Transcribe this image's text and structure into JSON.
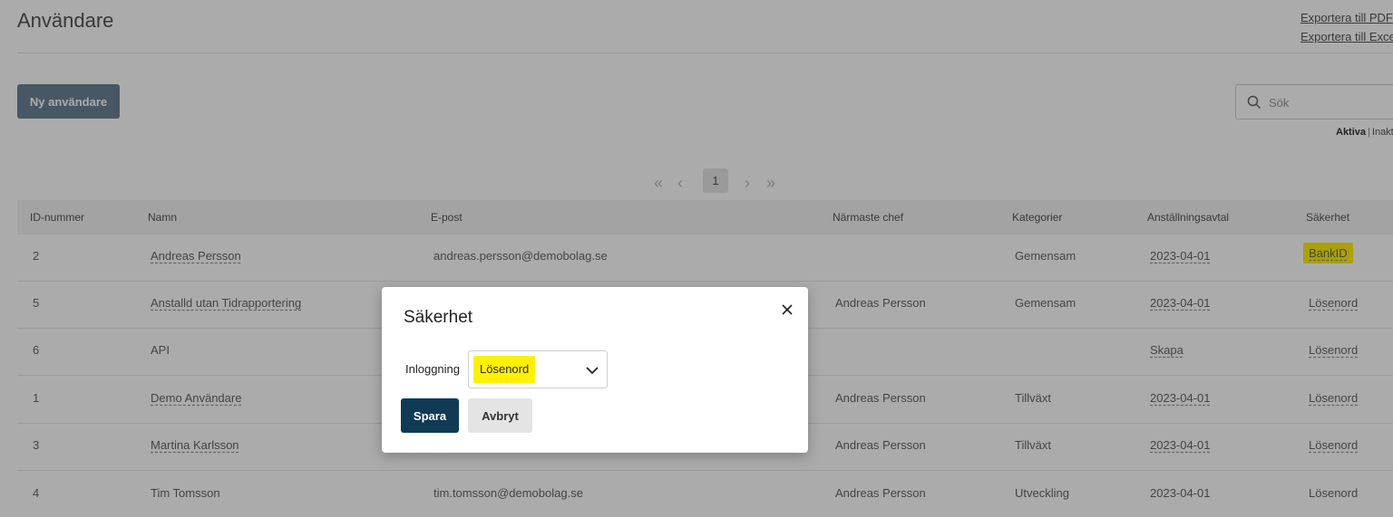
{
  "page": {
    "title": "Användare",
    "export_pdf": "Exportera till PDF",
    "export_excel": "Exportera till Excel",
    "new_user_label": "Ny användare",
    "search_placeholder": "Sök",
    "filter_active": "Aktiva",
    "filter_separator": "|",
    "filter_inactive": "Inaktiva",
    "pager": {
      "first": "«",
      "prev": "‹",
      "current": "1",
      "next": "›",
      "last": "»"
    }
  },
  "table": {
    "headers": [
      "ID-nummer",
      "Namn",
      "E-post",
      "Närmaste chef",
      "Kategorier",
      "Anställningsavtal",
      "Säkerhet"
    ],
    "rows": [
      {
        "id": "2",
        "name": "Andreas Persson",
        "email": "andreas.persson@demobolag.se",
        "manager": "",
        "category": "Gemensam",
        "contract": "2023-04-01",
        "security": "BankID"
      },
      {
        "id": "5",
        "name": "Anstalld utan Tidrapportering",
        "email": "",
        "manager": "Andreas Persson",
        "category": "Gemensam",
        "contract": "2023-04-01",
        "security": "Lösenord"
      },
      {
        "id": "6",
        "name": "API",
        "email": "",
        "manager": "",
        "category": "",
        "contract": "Skapa",
        "security": "Lösenord"
      },
      {
        "id": "1",
        "name": "Demo Användare",
        "email": "",
        "manager": "Andreas Persson",
        "category": "Tillväxt",
        "contract": "2023-04-01",
        "security": "Lösenord"
      },
      {
        "id": "3",
        "name": "Martina Karlsson",
        "email": "",
        "manager": "Andreas Persson",
        "category": "Tillväxt",
        "contract": "2023-04-01",
        "security": "Lösenord"
      },
      {
        "id": "4",
        "name": "Tim Tomsson",
        "email": "tim.tomsson@demobolag.se",
        "manager": "Andreas Persson",
        "category": "Utveckling",
        "contract": "2023-04-01",
        "security": "Lösenord"
      }
    ]
  },
  "modal": {
    "title": "Säkerhet",
    "login_label": "Inloggning",
    "login_value": "Lösenord",
    "save_label": "Spara",
    "cancel_label": "Avbryt"
  },
  "colors": {
    "highlight": "#fff100",
    "primary": "#0f3b55",
    "new_user_button": "#6b8396"
  }
}
